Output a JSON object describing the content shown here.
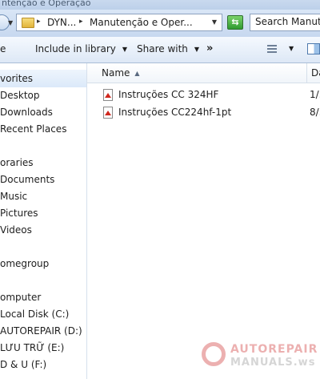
{
  "window": {
    "title": "ntenção e Operação"
  },
  "address": {
    "crumbs": [
      "DYN...",
      "Manutenção e Oper..."
    ],
    "search_placeholder": "Search Manut..."
  },
  "toolbar": {
    "items": [
      "e",
      "Include in library",
      "Share with"
    ],
    "more": "»"
  },
  "nav": {
    "items": [
      {
        "label": "vorites",
        "selected": true
      },
      {
        "label": "Desktop"
      },
      {
        "label": "Downloads"
      },
      {
        "label": "Recent Places"
      },
      {
        "label": "oraries"
      },
      {
        "label": "Documents"
      },
      {
        "label": "Music"
      },
      {
        "label": "Pictures"
      },
      {
        "label": "Videos"
      },
      {
        "label": "omegroup"
      },
      {
        "label": "omputer"
      },
      {
        "label": "Local Disk (C:)"
      },
      {
        "label": "AUTOREPAIR (D:)"
      },
      {
        "label": "LƯU TRỮ (E:)"
      },
      {
        "label": "D & U (F:)"
      }
    ]
  },
  "columns": {
    "name": "Name",
    "date": "Da"
  },
  "files": [
    {
      "name": "Instruções CC 324HF",
      "date": "1/."
    },
    {
      "name": "Instruções CC224hf-1pt",
      "date": "8/."
    }
  ],
  "watermark": {
    "line1": "AUTOREPAIR",
    "line2": "MANUALS.ws"
  },
  "icons": {
    "folder": "folder-icon",
    "pdf": "pdf-file-icon",
    "refresh": "refresh-icon",
    "view": "view-options-icon",
    "preview_pane": "preview-pane-icon"
  }
}
